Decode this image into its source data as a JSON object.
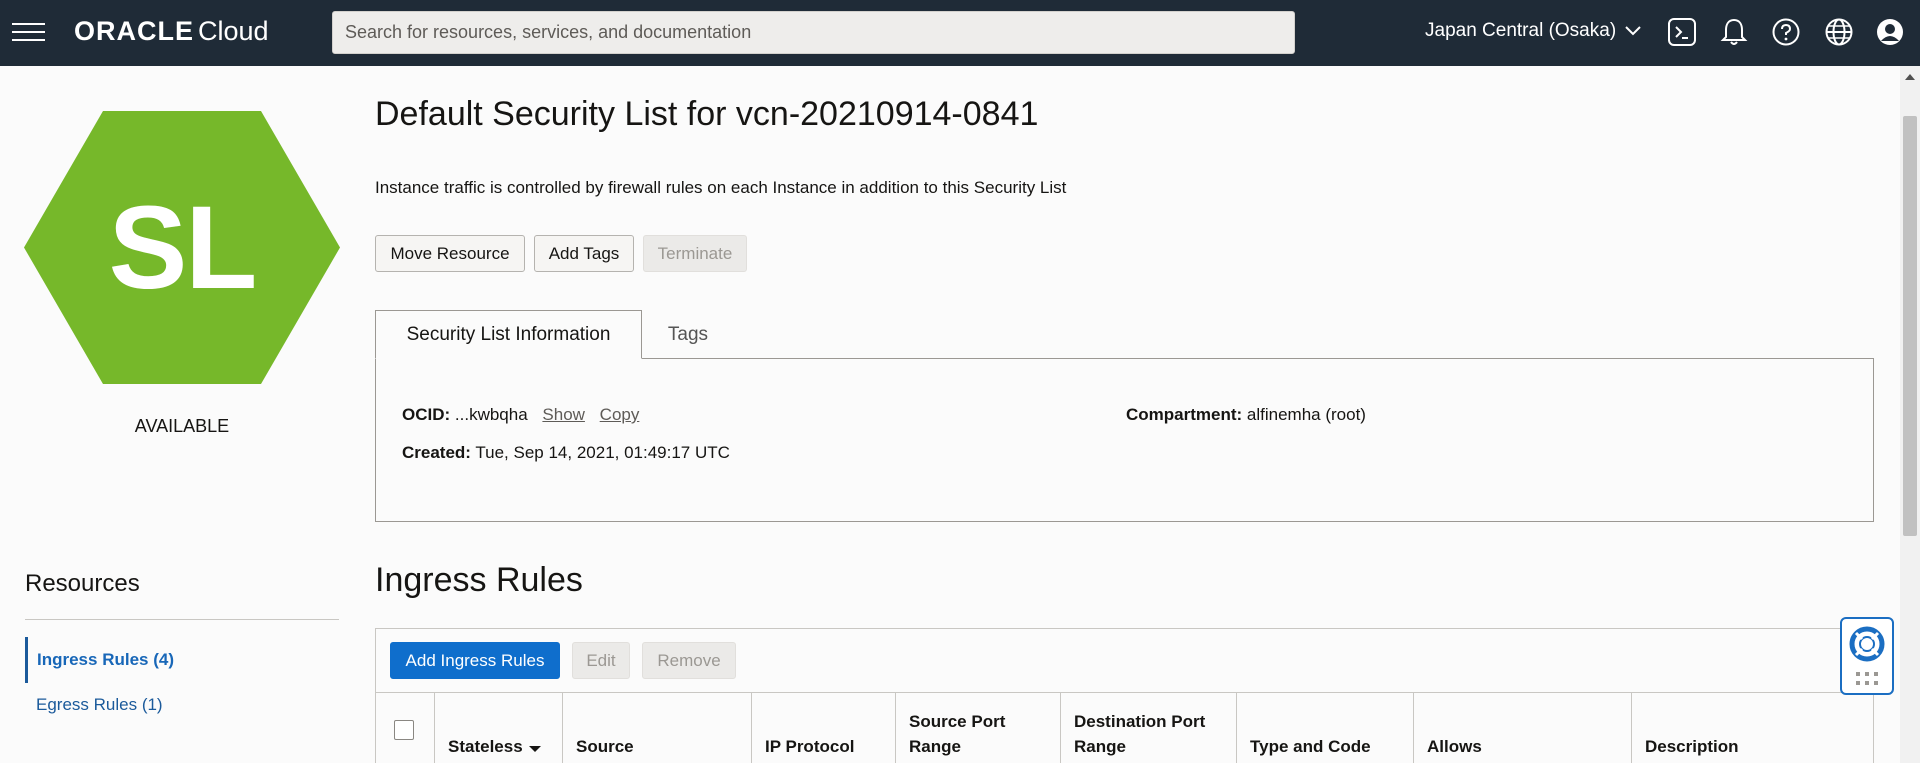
{
  "header": {
    "logo_oracle": "ORACLE",
    "logo_cloud": "Cloud",
    "search_placeholder": "Search for resources, services, and documentation",
    "region": "Japan Central (Osaka)",
    "icons": [
      "menu-icon",
      "cloud-shell-icon",
      "bell-icon",
      "help-icon",
      "globe-icon",
      "user-icon"
    ],
    "bg_color": "#1f2b37"
  },
  "resource": {
    "abbr": "SL",
    "status": "AVAILABLE",
    "badge_color": "#76b82a"
  },
  "sidebar": {
    "title": "Resources",
    "items": [
      {
        "label": "Ingress Rules (4)",
        "active": true
      },
      {
        "label": "Egress Rules (1)",
        "active": false
      }
    ]
  },
  "main": {
    "title": "Default Security List for vcn-20210914-0841",
    "subtitle": "Instance traffic is controlled by firewall rules on each Instance in addition to this Security List",
    "actions": {
      "move": "Move Resource",
      "add_tags": "Add Tags",
      "terminate": "Terminate"
    },
    "tabs": [
      "Security List Information",
      "Tags"
    ],
    "info": {
      "ocid_label": "OCID:",
      "ocid_value": "...kwbqha",
      "show": "Show",
      "copy": "Copy",
      "compartment_label": "Compartment:",
      "compartment_value": "alfinemha (root)",
      "created_label": "Created:",
      "created_value": "Tue, Sep 14, 2021, 01:49:17 UTC"
    }
  },
  "ingress": {
    "title": "Ingress Rules",
    "buttons": {
      "add": "Add Ingress Rules",
      "edit": "Edit",
      "remove": "Remove"
    },
    "columns": [
      "Stateless",
      "Source",
      "IP Protocol",
      "Source Port Range",
      "Destination Port Range",
      "Type and Code",
      "Allows",
      "Description"
    ]
  }
}
